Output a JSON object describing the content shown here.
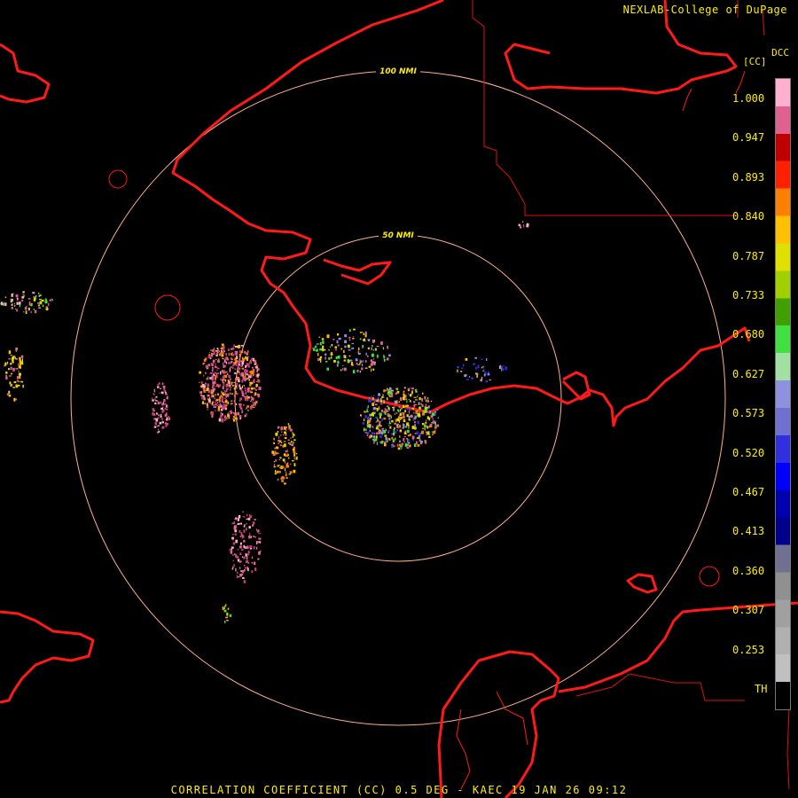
{
  "header": {
    "credit": "NEXLAB-College of DuPage"
  },
  "legend": {
    "product": "DCC",
    "units": "[CC]",
    "labels": [
      "1.000",
      "0.947",
      "0.893",
      "0.840",
      "0.787",
      "0.733",
      "0.680",
      "0.627",
      "0.573",
      "0.520",
      "0.467",
      "0.413",
      "0.360",
      "0.307",
      "0.253",
      "TH"
    ],
    "colors": [
      "#ffb0d0",
      "#e06090",
      "#c00000",
      "#ff2000",
      "#ff8000",
      "#ffc000",
      "#e0e000",
      "#a0d000",
      "#40a000",
      "#40e040",
      "#a0e0a0",
      "#9090e0",
      "#7070d0",
      "#3030e0",
      "#0000ff",
      "#0000b0",
      "#00008c",
      "#707090",
      "#909090",
      "#a0a0a0",
      "#b0b0b0",
      "#c0c0c0",
      "#000000"
    ]
  },
  "rings": [
    {
      "label": "50 NMI"
    },
    {
      "label": "100 NMI"
    }
  ],
  "footer": {
    "text": "CORRELATION COEFFICIENT (CC) 0.5 DEG - KAEC 19 JAN 26 09:12"
  },
  "colors": {
    "coast": "#ff1a1a",
    "ring": "#ffb090",
    "text": "#ffee00",
    "background": "#000000"
  }
}
